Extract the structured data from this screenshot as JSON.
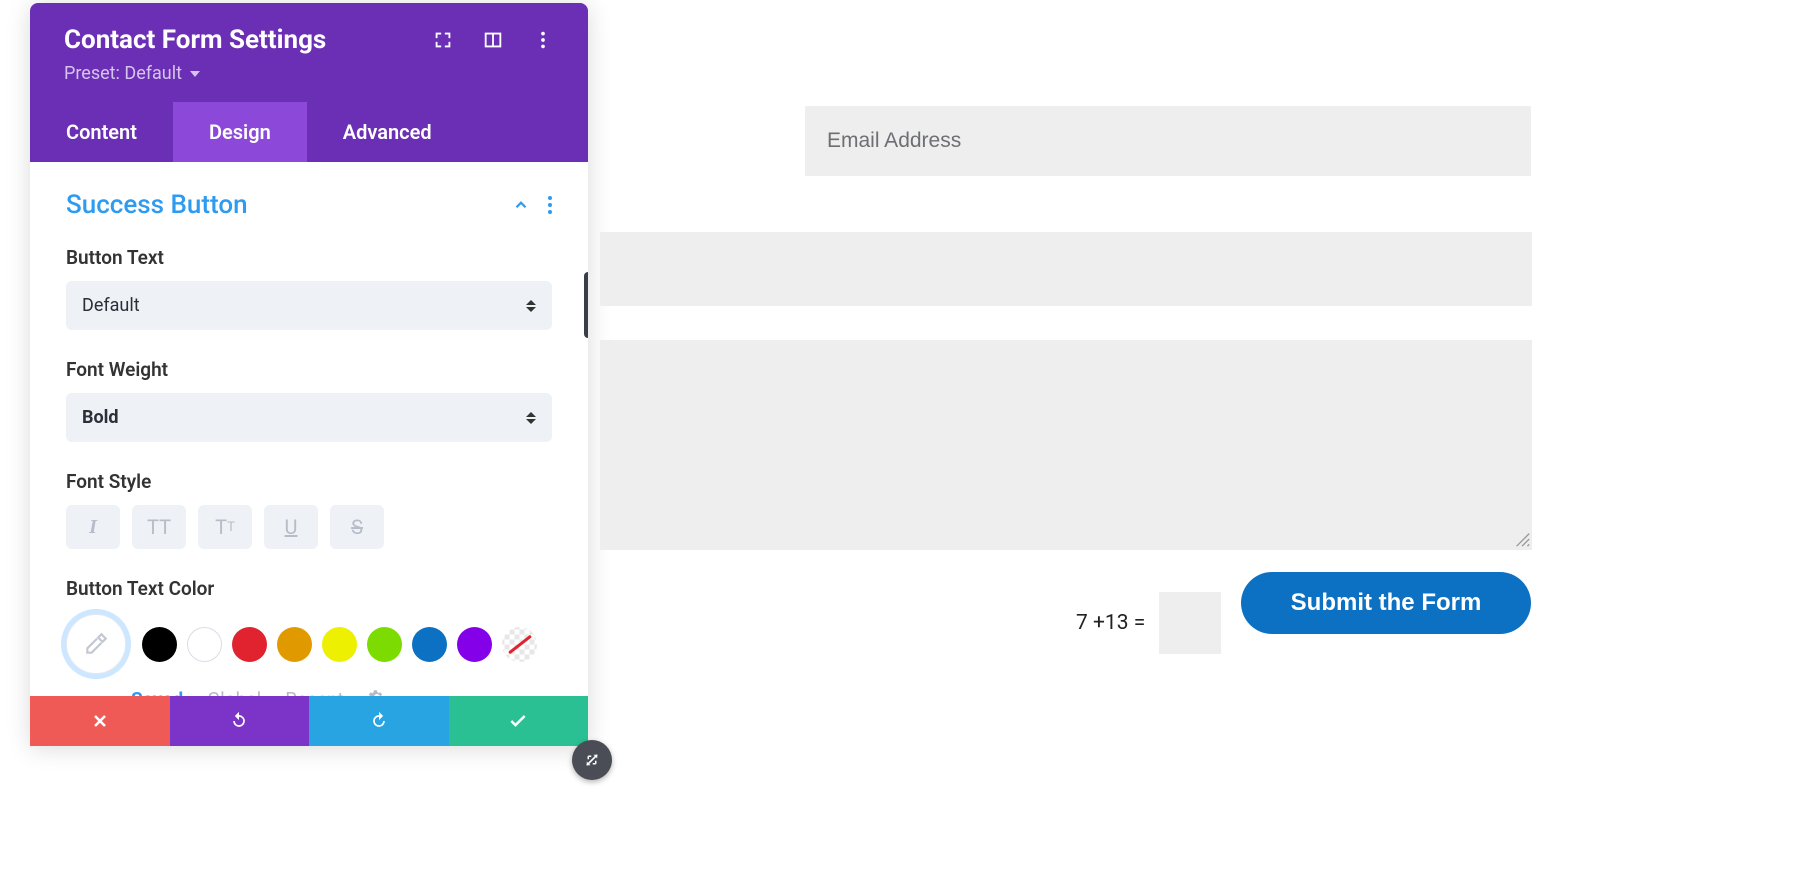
{
  "panel": {
    "title": "Contact Form Settings",
    "preset_label": "Preset: Default",
    "tabs": {
      "content": "Content",
      "design": "Design",
      "advanced": "Advanced",
      "active": "design"
    },
    "section": {
      "title": "Success Button",
      "button_text_label": "Button Text",
      "button_text_value": "Default",
      "font_weight_label": "Font Weight",
      "font_weight_value": "Bold",
      "font_style_label": "Font Style",
      "button_text_color_label": "Button Text Color",
      "swatches": [
        "#000000",
        "#ffffff",
        "#e0232e",
        "#e09a00",
        "#edf000",
        "#7cdb00",
        "#0c71c3",
        "#8300e9"
      ],
      "palette_tabs": {
        "saved": "Saved",
        "global": "Global",
        "recent": "Recent"
      }
    }
  },
  "form": {
    "email_placeholder": "Email Address",
    "captcha_text": "7 +13 =",
    "submit_label": "Submit the Form"
  },
  "colors": {
    "brand_purple": "#6b2fb5",
    "tab_active": "#8c48d9",
    "link_blue": "#2d9bf0",
    "submit_blue": "#0c71c3"
  }
}
